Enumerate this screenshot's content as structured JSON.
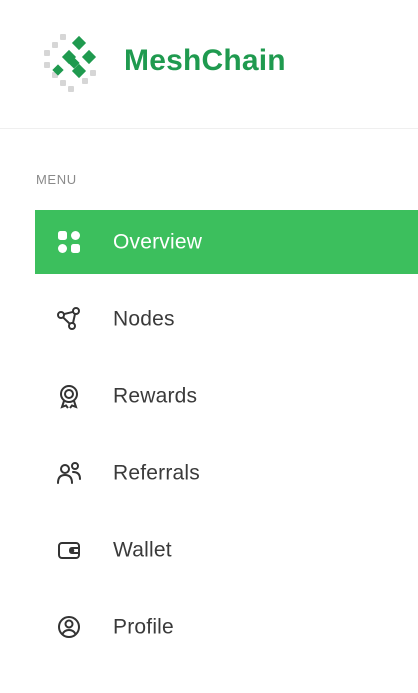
{
  "brand": {
    "name": "MeshChain"
  },
  "menu": {
    "label": "MENU",
    "items": [
      {
        "label": "Overview",
        "icon": "grid-icon",
        "active": true
      },
      {
        "label": "Nodes",
        "icon": "nodes-icon",
        "active": false
      },
      {
        "label": "Rewards",
        "icon": "rewards-icon",
        "active": false
      },
      {
        "label": "Referrals",
        "icon": "referrals-icon",
        "active": false
      },
      {
        "label": "Wallet",
        "icon": "wallet-icon",
        "active": false
      },
      {
        "label": "Profile",
        "icon": "profile-icon",
        "active": false
      }
    ]
  },
  "colors": {
    "accent": "#3cbf5d",
    "brand_text": "#1f9a4f"
  }
}
